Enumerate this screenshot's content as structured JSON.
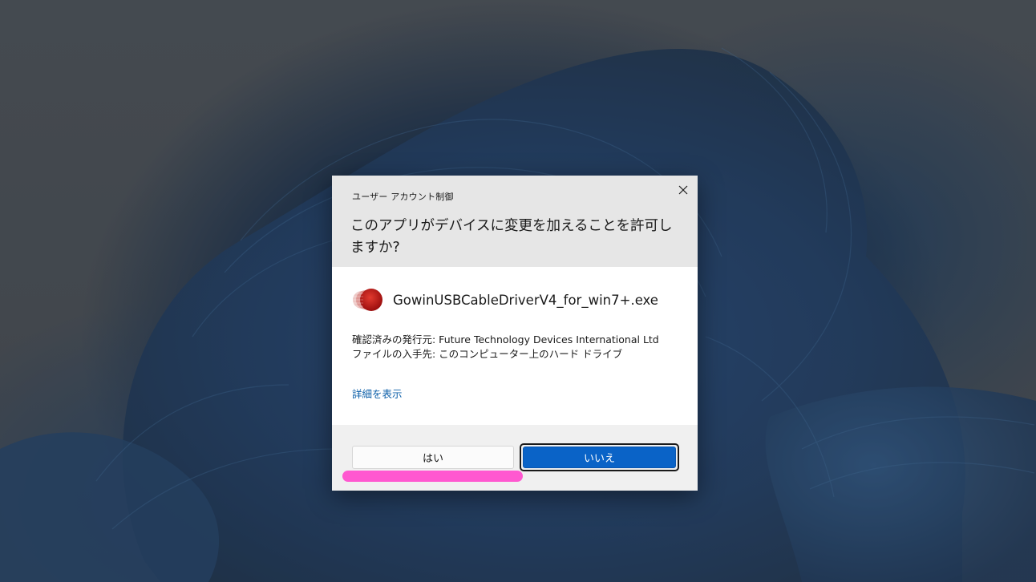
{
  "dialog": {
    "caption": "ユーザー アカウント制御",
    "question": "このアプリがデバイスに変更を加えることを許可しますか?",
    "app_name": "GowinUSBCableDriverV4_for_win7+.exe",
    "publisher_line": "確認済みの発行元: Future Technology Devices International Ltd",
    "origin_line": "ファイルの入手先: このコンピューター上のハード ドライブ",
    "details_link": "詳細を表示",
    "yes_label": "はい",
    "no_label": "いいえ",
    "close_icon": "close-icon",
    "app_icon": "red-disc-app-icon"
  },
  "colors": {
    "accent": "#0a63c7",
    "highlight": "#ff4fce",
    "link": "#0a5ea8"
  }
}
